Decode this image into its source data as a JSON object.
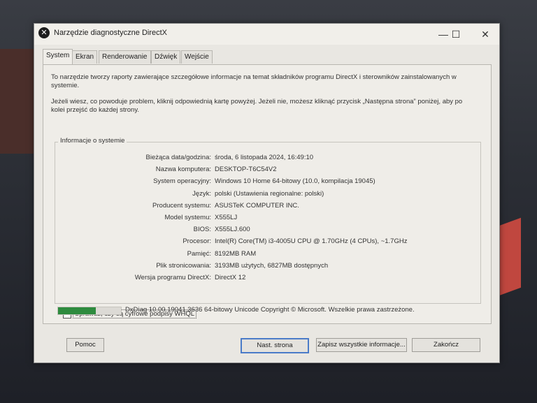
{
  "window": {
    "title": "Narzędzie diagnostyczne DirectX",
    "minimize": "—",
    "maximize": "☐",
    "close": "✕"
  },
  "tabs": [
    "System",
    "Ekran",
    "Renderowanie",
    "Dźwięk",
    "Wejście"
  ],
  "intro": {
    "p1": "To narzędzie tworzy raporty zawierające szczegółowe informacje na temat składników programu DirectX i sterowników zainstalowanych w systemie.",
    "p2": "Jeżeli wiesz, co powoduje problem, kliknij odpowiednią kartę powyżej. Jeżeli nie, możesz kliknąć przycisk „Następna strona” poniżej, aby po kolei przejść do każdej strony."
  },
  "system_info": {
    "group_label": "Informacje o systemie",
    "rows": [
      {
        "label": "Bieżąca data/godzina:",
        "value": "środa, 6 listopada 2024, 16:49:10"
      },
      {
        "label": "Nazwa komputera:",
        "value": "DESKTOP-T6C54V2"
      },
      {
        "label": "System operacyjny:",
        "value": "Windows 10 Home 64-bitowy (10.0, kompilacja 19045)"
      },
      {
        "label": "Język:",
        "value": "polski (Ustawienia regionalne: polski)"
      },
      {
        "label": "Producent systemu:",
        "value": "ASUSTeK COMPUTER INC."
      },
      {
        "label": "Model systemu:",
        "value": "X555LJ"
      },
      {
        "label": "BIOS:",
        "value": "X555LJ.600"
      },
      {
        "label": "Procesor:",
        "value": "Intel(R) Core(TM) i3-4005U CPU @ 1.70GHz (4 CPUs), ~1.7GHz"
      },
      {
        "label": "Pamięć:",
        "value": "8192MB RAM"
      },
      {
        "label": "Plik stronicowania:",
        "value": "3193MB użytych, 6827MB dostępnych"
      },
      {
        "label": "Wersja programu DirectX:",
        "value": "DirectX 12"
      }
    ]
  },
  "whql_checkbox": {
    "label": "Sprawdź, czy są cyfrowe podpisy WHQL",
    "checked": false
  },
  "progress": 0.6,
  "status_text": "DxDiag 10.00.19041.3636 64-bitowy Unicode  Copyright © Microsoft. Wszelkie prawa zastrzeżone.",
  "buttons": {
    "help": "Pomoc",
    "next": "Nast. strona",
    "save": "Zapisz wszystkie informacje...",
    "exit": "Zakończ"
  }
}
